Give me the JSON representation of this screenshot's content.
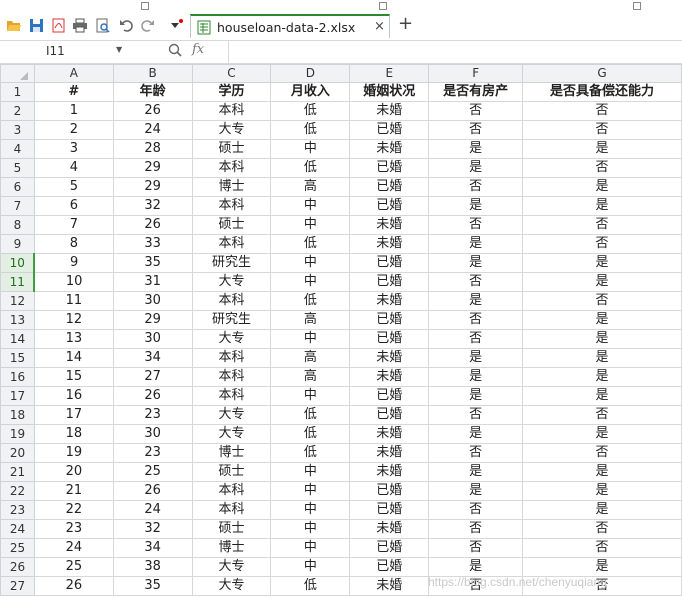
{
  "toolbar": {
    "icons": [
      "open-folder-icon",
      "save-icon",
      "export-pdf-icon",
      "print-icon",
      "print-preview-icon",
      "undo-icon",
      "redo-icon",
      "more-dropdown-icon"
    ]
  },
  "file_tab": {
    "name": "houseloan-data-2.xlsx",
    "close": "×",
    "add": "+"
  },
  "formula_bar": {
    "cell_ref": "I11",
    "fx": "fx",
    "value": ""
  },
  "sheet": {
    "columns": [
      "A",
      "B",
      "C",
      "D",
      "E",
      "F",
      "G"
    ],
    "row_numbers": [
      "1",
      "2",
      "3",
      "4",
      "5",
      "6",
      "7",
      "8",
      "9",
      "10",
      "11",
      "12",
      "13",
      "14",
      "15",
      "16",
      "17",
      "18",
      "19",
      "20",
      "21",
      "22",
      "23",
      "24",
      "25",
      "26",
      "27"
    ],
    "header": [
      "#",
      "年龄",
      "学历",
      "月收入",
      "婚姻状况",
      "是否有房产",
      "是否具备偿还能力"
    ],
    "rows": [
      [
        "1",
        "26",
        "本科",
        "低",
        "未婚",
        "否",
        "否"
      ],
      [
        "2",
        "24",
        "大专",
        "低",
        "已婚",
        "否",
        "否"
      ],
      [
        "3",
        "28",
        "硕士",
        "中",
        "未婚",
        "是",
        "是"
      ],
      [
        "4",
        "29",
        "本科",
        "低",
        "已婚",
        "是",
        "否"
      ],
      [
        "5",
        "29",
        "博士",
        "高",
        "已婚",
        "否",
        "是"
      ],
      [
        "6",
        "32",
        "本科",
        "中",
        "已婚",
        "是",
        "是"
      ],
      [
        "7",
        "26",
        "硕士",
        "中",
        "未婚",
        "否",
        "否"
      ],
      [
        "8",
        "33",
        "本科",
        "低",
        "未婚",
        "是",
        "否"
      ],
      [
        "9",
        "35",
        "研究生",
        "中",
        "已婚",
        "是",
        "是"
      ],
      [
        "10",
        "31",
        "大专",
        "中",
        "已婚",
        "否",
        "是"
      ],
      [
        "11",
        "30",
        "本科",
        "低",
        "未婚",
        "是",
        "否"
      ],
      [
        "12",
        "29",
        "研究生",
        "高",
        "已婚",
        "否",
        "是"
      ],
      [
        "13",
        "30",
        "大专",
        "中",
        "已婚",
        "否",
        "是"
      ],
      [
        "14",
        "34",
        "本科",
        "高",
        "未婚",
        "是",
        "是"
      ],
      [
        "15",
        "27",
        "本科",
        "高",
        "未婚",
        "是",
        "是"
      ],
      [
        "16",
        "26",
        "本科",
        "中",
        "已婚",
        "是",
        "是"
      ],
      [
        "17",
        "23",
        "大专",
        "低",
        "已婚",
        "否",
        "否"
      ],
      [
        "18",
        "30",
        "大专",
        "低",
        "未婚",
        "是",
        "是"
      ],
      [
        "19",
        "23",
        "博士",
        "低",
        "未婚",
        "否",
        "否"
      ],
      [
        "20",
        "25",
        "硕士",
        "中",
        "未婚",
        "是",
        "是"
      ],
      [
        "21",
        "26",
        "本科",
        "中",
        "已婚",
        "是",
        "是"
      ],
      [
        "22",
        "24",
        "本科",
        "中",
        "已婚",
        "否",
        "是"
      ],
      [
        "23",
        "32",
        "硕士",
        "中",
        "未婚",
        "否",
        "否"
      ],
      [
        "24",
        "34",
        "博士",
        "中",
        "已婚",
        "否",
        "否"
      ],
      [
        "25",
        "38",
        "大专",
        "中",
        "已婚",
        "是",
        "是"
      ],
      [
        "26",
        "35",
        "大专",
        "低",
        "未婚",
        "否",
        "否"
      ]
    ]
  },
  "watermark": "https://blog.csdn.net/chenyuqiang",
  "colors": {
    "accent_green": "#2c8a2c",
    "header_bg": "#f1f2f4",
    "grid_line": "#d8d8d8"
  }
}
